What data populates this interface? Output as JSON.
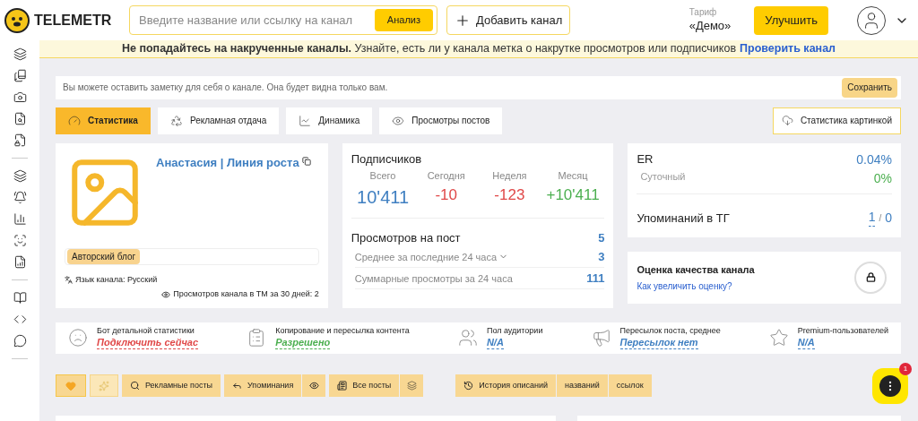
{
  "header": {
    "logo": "TELEMETR",
    "search_placeholder": "Введите название или ссылку на канал",
    "analyze": "Анализ",
    "add_channel": "Добавить канал",
    "tariff_label": "Тариф",
    "tariff": "«Демо»",
    "upgrade": "Улучшить"
  },
  "banner": {
    "text": "**Не попадайтесь на накрученные каналы.** Узнайте, есть ли у канала метка о накрутке просмотров или подписчиков",
    "link": "Проверить канал"
  },
  "note": {
    "placeholder": "Вы можете оставить заметку для себя о канале. Она будет видна только вам.",
    "save": "Сохранить"
  },
  "tabs": [
    {
      "label": "Статистика",
      "selected": true
    },
    {
      "label": "Рекламная отдача",
      "selected": false
    },
    {
      "label": "Динамика",
      "selected": false
    },
    {
      "label": "Просмотры постов",
      "selected": false
    }
  ],
  "export": "Статистика картинкой",
  "channel": {
    "name": "Анастасия | Линия роста",
    "tag": "Авторский блог",
    "language": "Язык канала: Русский",
    "tm_views": "Просмотров канала в ТМ за 30 дней: 2"
  },
  "subscribers": {
    "title": "Подписчиков",
    "columns": [
      {
        "label": "Всего",
        "value": "10'411",
        "color": "#3f7fc1"
      },
      {
        "label": "Сегодня",
        "value": "-10",
        "color": "#e04848"
      },
      {
        "label": "Неделя",
        "value": "-123",
        "color": "#e04848"
      },
      {
        "label": "Месяц",
        "value": "+10'411",
        "color": "#4caf50"
      }
    ]
  },
  "views": {
    "title": "Просмотров на пост",
    "value": "5",
    "rows": [
      {
        "label": "Среднее за последние 24 часа",
        "value": "3",
        "expandable": true
      },
      {
        "label": "Суммарные просмотры за 24 часа",
        "value": "111",
        "expandable": false
      }
    ]
  },
  "er": {
    "title": "ER",
    "value": "0.04%",
    "daily_label": "Суточный",
    "daily_value": "0%"
  },
  "mentions": {
    "title": "Упоминаний в ТГ",
    "value_a": "1",
    "separator": "/",
    "value_b": "0"
  },
  "quality": {
    "title": "Оценка качества канала",
    "link": "Как увеличить оценку?"
  },
  "features": [
    {
      "title": "Бот детальной статистики",
      "value": "Подключить сейчас",
      "kind": "warning"
    },
    {
      "title": "Копирование и пересылка контента",
      "value": "Разрешено",
      "kind": "ok"
    },
    {
      "title": "Пол аудитории",
      "value": "N/A",
      "kind": "info"
    },
    {
      "title": "Пересылок поста, среднее",
      "value": "Пересылок нет",
      "kind": "info"
    },
    {
      "title": "Premium-пользователей",
      "value": "N/A",
      "kind": "info"
    }
  ],
  "actions": [
    {
      "label": "Рекламные посты"
    },
    {
      "label": "Упоминания"
    },
    {
      "label": "Все посты"
    }
  ],
  "history": [
    "История описаний",
    "названий",
    "ссылок"
  ],
  "chat_badge": "1"
}
